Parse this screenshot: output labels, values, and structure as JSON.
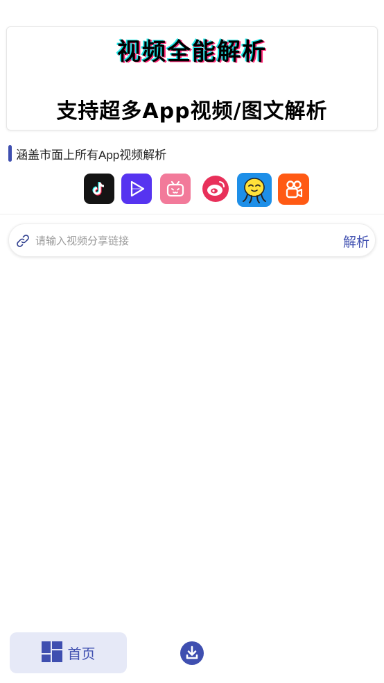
{
  "banner": {
    "title": "视频全能解析",
    "subtitle": "支持超多App视频/图文解析"
  },
  "section": {
    "label": "涵盖市面上所有App视频解析"
  },
  "apps": [
    {
      "icon": "tiktok-icon",
      "color": "#111111"
    },
    {
      "icon": "play-video-icon",
      "color": "#5b3cf5"
    },
    {
      "icon": "bilibili-icon",
      "color": "#f07896"
    },
    {
      "icon": "weibo-icon",
      "color": "#e8305a"
    },
    {
      "icon": "qq-octopus-icon",
      "color": "#1f8fe6"
    },
    {
      "icon": "kuaishou-icon",
      "color": "#ff5a14"
    }
  ],
  "search": {
    "placeholder": "请输入视频分享链接",
    "value": "",
    "button_label": "解析"
  },
  "nav": {
    "home_label": "首页",
    "accent": "#3f4fb0"
  }
}
